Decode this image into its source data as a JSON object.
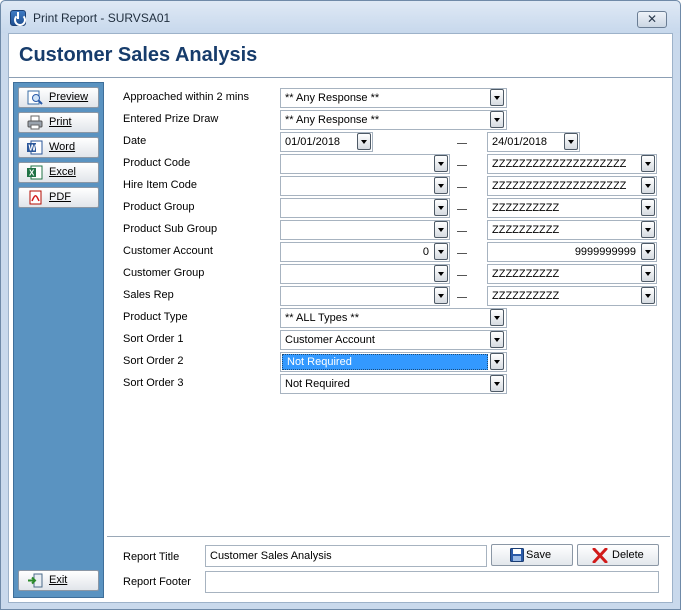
{
  "window": {
    "title": "Print Report - SURVSA01",
    "close_glyph": "✕"
  },
  "header": {
    "title": "Customer Sales Analysis"
  },
  "sidebar": {
    "preview": "Preview",
    "print": "Print",
    "word": "Word",
    "excel": "Excel",
    "pdf": "PDF",
    "exit": "Exit"
  },
  "form": {
    "approached": {
      "label": "Approached within 2 mins",
      "value": "** Any Response **"
    },
    "prize_draw": {
      "label": "Entered Prize Draw",
      "value": "** Any Response **"
    },
    "date": {
      "label": "Date",
      "from": "01/01/2018",
      "to": "24/01/2018"
    },
    "product_code": {
      "label": "Product Code",
      "from": "",
      "to": "ZZZZZZZZZZZZZZZZZZZZ"
    },
    "hire_item_code": {
      "label": "Hire Item Code",
      "from": "",
      "to": "ZZZZZZZZZZZZZZZZZZZZ"
    },
    "product_group": {
      "label": "Product Group",
      "from": "",
      "to": "ZZZZZZZZZZ"
    },
    "product_sub_group": {
      "label": "Product Sub Group",
      "from": "",
      "to": "ZZZZZZZZZZ"
    },
    "customer_account": {
      "label": "Customer Account",
      "from": "0",
      "to": "9999999999"
    },
    "customer_group": {
      "label": "Customer Group",
      "from": "",
      "to": "ZZZZZZZZZZ"
    },
    "sales_rep": {
      "label": "Sales Rep",
      "from": "",
      "to": "ZZZZZZZZZZ"
    },
    "product_type": {
      "label": "Product Type",
      "value": "** ALL Types **"
    },
    "sort1": {
      "label": "Sort Order 1",
      "value": "Customer Account"
    },
    "sort2": {
      "label": "Sort Order 2",
      "value": "Not Required"
    },
    "sort3": {
      "label": "Sort Order 3",
      "value": "Not Required"
    }
  },
  "footer": {
    "title_label": "Report Title",
    "title_value": "Customer Sales Analysis",
    "footer_label": "Report Footer",
    "footer_value": "",
    "save": "Save",
    "delete": "Delete"
  },
  "colors": {
    "sidebar": "#5a93c1",
    "header_title": "#173c6b",
    "selection": "#3399ff",
    "delete_icon": "#d11a1a",
    "save_icon": "#2a5aa8"
  },
  "icons": [
    "power-icon",
    "close-icon",
    "preview-icon",
    "printer-icon",
    "word-icon",
    "excel-icon",
    "pdf-icon",
    "exit-icon",
    "save-icon",
    "delete-icon",
    "chevron-down-icon"
  ]
}
